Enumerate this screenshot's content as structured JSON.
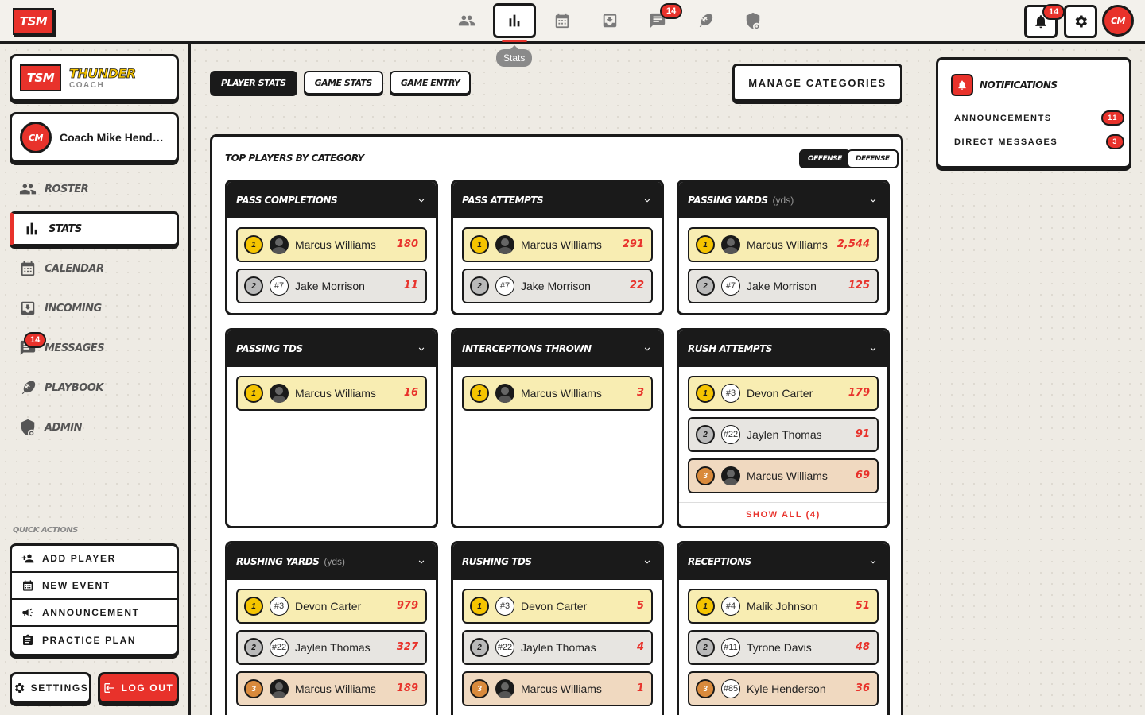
{
  "app": {
    "logo": "TSM"
  },
  "topnav": {
    "items": [
      {
        "id": "roster",
        "icon": "people-icon"
      },
      {
        "id": "stats",
        "icon": "bar-chart-icon",
        "active": true
      },
      {
        "id": "calendar",
        "icon": "calendar-icon"
      },
      {
        "id": "incoming",
        "icon": "inbox-icon"
      },
      {
        "id": "messages",
        "icon": "chat-icon",
        "badge": "14"
      },
      {
        "id": "playbook",
        "icon": "football-icon"
      },
      {
        "id": "admin",
        "icon": "shield-gear-icon"
      }
    ],
    "tooltip": "Stats"
  },
  "topright": {
    "notif_badge": "14",
    "avatar_initials": "CM"
  },
  "sidebar": {
    "brand": {
      "logo": "TSM",
      "name": "THUNDER",
      "role": "COACH"
    },
    "user": {
      "initials": "CM",
      "name": "Coach Mike Henderson"
    },
    "nav": [
      {
        "label": "ROSTER",
        "icon": "people-icon"
      },
      {
        "label": "STATS",
        "icon": "bar-chart-icon",
        "active": true
      },
      {
        "label": "CALENDAR",
        "icon": "calendar-icon"
      },
      {
        "label": "INCOMING",
        "icon": "inbox-icon"
      },
      {
        "label": "MESSAGES",
        "icon": "chat-icon",
        "badge": "14"
      },
      {
        "label": "PLAYBOOK",
        "icon": "football-icon"
      },
      {
        "label": "ADMIN",
        "icon": "shield-gear-icon"
      }
    ],
    "quick_actions_title": "QUICK ACTIONS",
    "quick_actions": [
      {
        "label": "ADD PLAYER",
        "icon": "person-add-icon"
      },
      {
        "label": "NEW EVENT",
        "icon": "calendar-icon"
      },
      {
        "label": "ANNOUNCEMENT",
        "icon": "megaphone-icon"
      },
      {
        "label": "PRACTICE PLAN",
        "icon": "clipboard-icon"
      }
    ],
    "settings_label": "SETTINGS",
    "logout_label": "LOG OUT"
  },
  "main": {
    "tabs": [
      {
        "label": "PLAYER STATS",
        "active": true
      },
      {
        "label": "GAME STATS"
      },
      {
        "label": "GAME ENTRY"
      }
    ],
    "manage_label": "MANAGE CATEGORIES",
    "panel_title": "TOP PLAYERS BY CATEGORY",
    "toggle": {
      "offense": "OFFENSE",
      "defense": "DEFENSE"
    },
    "categories": [
      {
        "title": "PASS COMPLETIONS",
        "unit": "",
        "rows": [
          {
            "rank": "1",
            "jersey": "",
            "name": "Marcus Williams",
            "value": "180"
          },
          {
            "rank": "2",
            "jersey": "#7",
            "name": "Jake Morrison",
            "value": "11"
          }
        ]
      },
      {
        "title": "PASS ATTEMPTS",
        "unit": "",
        "rows": [
          {
            "rank": "1",
            "jersey": "",
            "name": "Marcus Williams",
            "value": "291"
          },
          {
            "rank": "2",
            "jersey": "#7",
            "name": "Jake Morrison",
            "value": "22"
          }
        ]
      },
      {
        "title": "PASSING YARDS",
        "unit": "(yds)",
        "rows": [
          {
            "rank": "1",
            "jersey": "",
            "name": "Marcus Williams",
            "value": "2,544"
          },
          {
            "rank": "2",
            "jersey": "#7",
            "name": "Jake Morrison",
            "value": "125"
          }
        ]
      },
      {
        "title": "PASSING TDS",
        "unit": "",
        "rows": [
          {
            "rank": "1",
            "jersey": "",
            "name": "Marcus Williams",
            "value": "16"
          }
        ]
      },
      {
        "title": "INTERCEPTIONS THROWN",
        "unit": "",
        "rows": [
          {
            "rank": "1",
            "jersey": "",
            "name": "Marcus Williams",
            "value": "3"
          }
        ]
      },
      {
        "title": "RUSH ATTEMPTS",
        "unit": "",
        "show_all": "SHOW ALL (4)",
        "rows": [
          {
            "rank": "1",
            "jersey": "#3",
            "name": "Devon Carter",
            "value": "179"
          },
          {
            "rank": "2",
            "jersey": "#22",
            "name": "Jaylen Thomas",
            "value": "91"
          },
          {
            "rank": "3",
            "jersey": "",
            "name": "Marcus Williams",
            "value": "69"
          }
        ]
      },
      {
        "title": "RUSHING YARDS",
        "unit": "(yds)",
        "rows": [
          {
            "rank": "1",
            "jersey": "#3",
            "name": "Devon Carter",
            "value": "979"
          },
          {
            "rank": "2",
            "jersey": "#22",
            "name": "Jaylen Thomas",
            "value": "327"
          },
          {
            "rank": "3",
            "jersey": "",
            "name": "Marcus Williams",
            "value": "189"
          }
        ]
      },
      {
        "title": "RUSHING TDS",
        "unit": "",
        "rows": [
          {
            "rank": "1",
            "jersey": "#3",
            "name": "Devon Carter",
            "value": "5"
          },
          {
            "rank": "2",
            "jersey": "#22",
            "name": "Jaylen Thomas",
            "value": "4"
          },
          {
            "rank": "3",
            "jersey": "",
            "name": "Marcus Williams",
            "value": "1"
          }
        ]
      },
      {
        "title": "RECEPTIONS",
        "unit": "",
        "rows": [
          {
            "rank": "1",
            "jersey": "#4",
            "name": "Malik Johnson",
            "value": "51"
          },
          {
            "rank": "2",
            "jersey": "#11",
            "name": "Tyrone Davis",
            "value": "48"
          },
          {
            "rank": "3",
            "jersey": "#85",
            "name": "Kyle Henderson",
            "value": "36"
          }
        ]
      }
    ]
  },
  "notifications": {
    "title": "NOTIFICATIONS",
    "items": [
      {
        "label": "ANNOUNCEMENTS",
        "count": "11"
      },
      {
        "label": "DIRECT MESSAGES",
        "count": "3"
      }
    ]
  },
  "colors": {
    "accent": "#e8322b",
    "gold": "#f5c400",
    "ink": "#1a1a1a",
    "background": "#eeebe4"
  }
}
